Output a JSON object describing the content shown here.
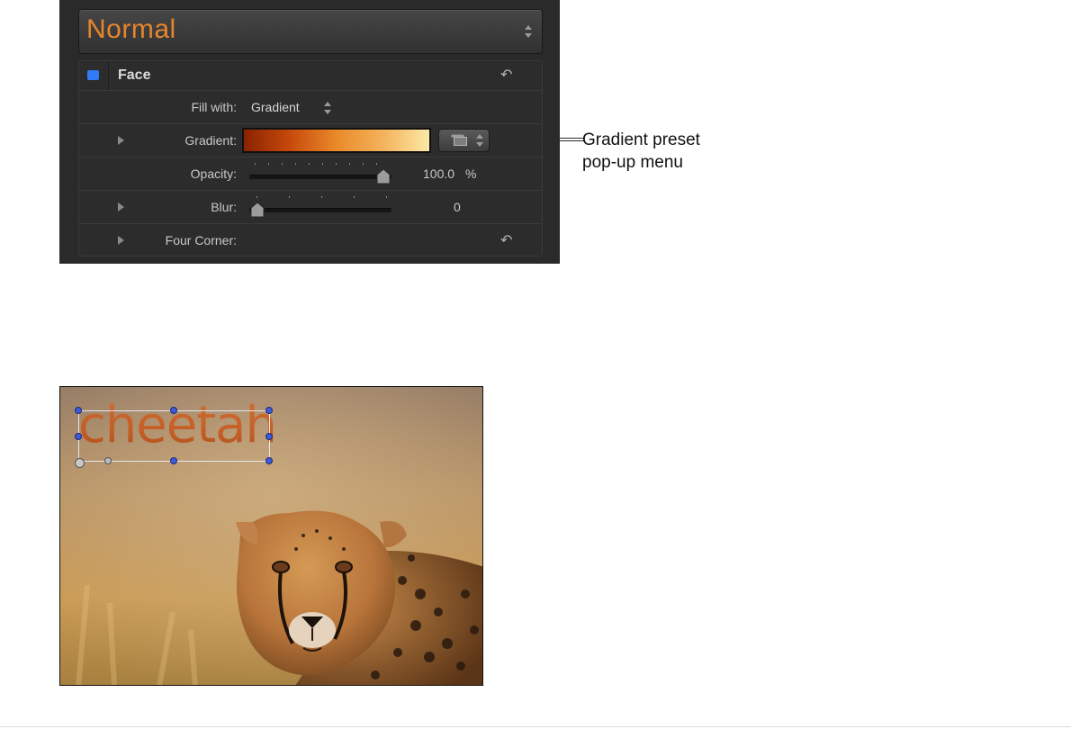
{
  "inspector": {
    "style_popup_value": "Normal",
    "group": {
      "title": "Face",
      "enabled": true,
      "rows": {
        "fill_with": {
          "label": "Fill with:",
          "value": "Gradient"
        },
        "gradient": {
          "label": "Gradient:"
        },
        "opacity": {
          "label": "Opacity:",
          "value": "100.0",
          "unit": "%",
          "fraction": 1.0
        },
        "blur": {
          "label": "Blur:",
          "value": "0",
          "fraction": 0.0
        },
        "four_corner": {
          "label": "Four Corner:"
        }
      }
    },
    "colors": {
      "accent_text": "#e8852c",
      "checkbox": "#2f7bf5",
      "gradient_stops": [
        "#8a2200",
        "#c74a0c",
        "#ea8a2a",
        "#f4b25b",
        "#fbe9a6"
      ]
    }
  },
  "callout": {
    "line1": "Gradient preset",
    "line2": "pop-up menu"
  },
  "canvas": {
    "text": "cheetah",
    "subject": "cheetah photo"
  }
}
